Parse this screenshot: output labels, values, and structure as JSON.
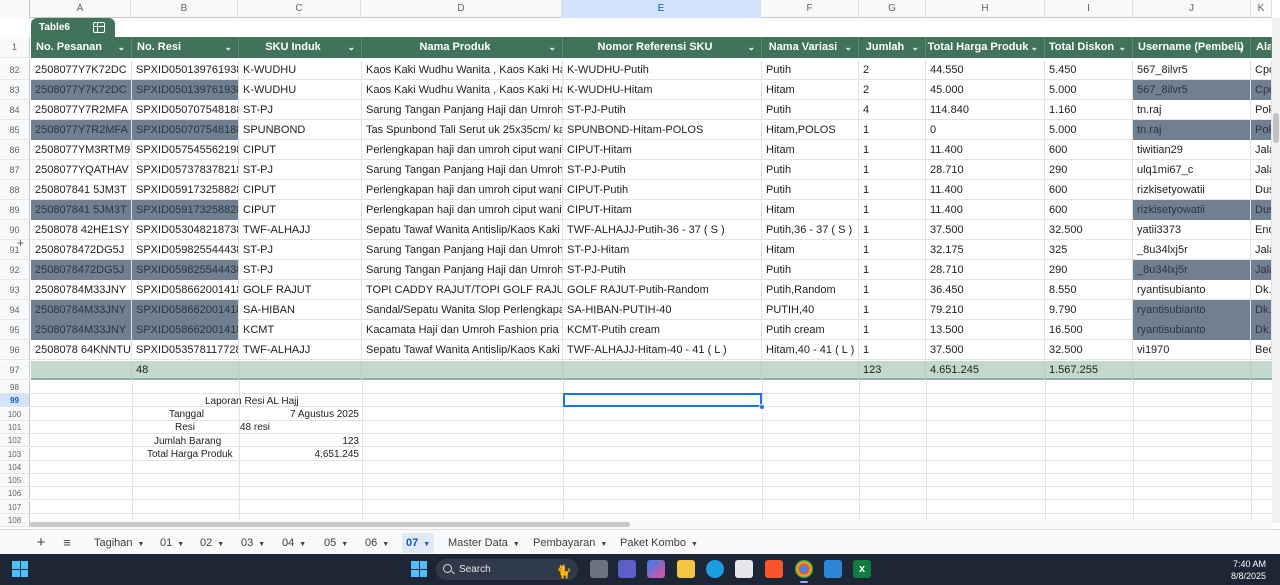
{
  "table_name": "Table6",
  "col_letters": [
    "A",
    "B",
    "C",
    "D",
    "E",
    "F",
    "G",
    "H",
    "I",
    "J",
    "K"
  ],
  "headers": [
    "No. Pesanan",
    "No. Resi",
    "SKU Induk",
    "Nama Produk",
    "Nomor Referensi SKU",
    "Nama Variasi",
    "Jumlah",
    "Total Harga Produk",
    "Total Diskon",
    "Username (Pembeli)",
    "Alan"
  ],
  "header_row_num": "1",
  "rows": [
    {
      "n": "82",
      "hl": false,
      "c": [
        "2508077Y7K72DC",
        "SPXID050139761938",
        "K-WUDHU",
        "Kaos Kaki Wudhu Wanita , Kaos Kaki Haji Da",
        "K-WUDHU-Putih",
        "Putih",
        "2",
        "44.550",
        "5.450",
        "567_8ilvr5",
        "Cpd"
      ]
    },
    {
      "n": "83",
      "hl": true,
      "c": [
        "2508077Y7K72DC",
        "SPXID050139761938",
        "K-WUDHU",
        "Kaos Kaki Wudhu Wanita , Kaos Kaki Haji Da",
        "K-WUDHU-Hitam",
        "Hitam",
        "2",
        "45.000",
        "5.000",
        "567_8ilvr5",
        "Cpd"
      ]
    },
    {
      "n": "84",
      "hl": false,
      "c": [
        "2508077Y7R2MFA",
        "SPXID050707548188",
        "ST-PJ",
        "Sarung Tangan Panjang Haji dan Umroh Wan",
        "ST-PJ-Putih",
        "Putih",
        "4",
        "114.840",
        "1.160",
        "tn.raj",
        "Pok"
      ]
    },
    {
      "n": "85",
      "hl": true,
      "c": [
        "2508077Y7R2MFA",
        "SPXID050707548188",
        "SPUNBOND",
        "Tas Spunbond Tali Serut uk 25x35cm/ kantor",
        "SPUNBOND-Hitam-POLOS",
        "Hitam,POLOS",
        "1",
        "0",
        "5.000",
        "tn.raj",
        "Pok"
      ]
    },
    {
      "n": "86",
      "hl": false,
      "c": [
        "2508077YM3RTM9",
        "SPXID057545562198",
        "CIPUT",
        "Perlengkapan haji dan umroh ciput wanita /ci",
        "CIPUT-Hitam",
        "Hitam",
        "1",
        "11.400",
        "600",
        "tiwitian29",
        "Jala"
      ]
    },
    {
      "n": "87",
      "hl": false,
      "c": [
        "2508077YQATHAV",
        "SPXID057378378218",
        "ST-PJ",
        "Sarung Tangan Panjang Haji dan Umroh Wan",
        "ST-PJ-Putih",
        "Putih",
        "1",
        "28.710",
        "290",
        "ulq1mi67_c",
        "Jala"
      ]
    },
    {
      "n": "88",
      "hl": false,
      "c": [
        "250807841 5JM3T",
        "SPXID059173258828",
        "CIPUT",
        "Perlengkapan haji dan umroh ciput wanita /ci",
        "CIPUT-Putih",
        "Putih",
        "1",
        "11.400",
        "600",
        "rizkisetyowatii",
        "Dus"
      ]
    },
    {
      "n": "89",
      "hl": true,
      "c": [
        "250807841 5JM3T",
        "SPXID059173258828",
        "CIPUT",
        "Perlengkapan haji dan umroh ciput wanita /ci",
        "CIPUT-Hitam",
        "Hitam",
        "1",
        "11.400",
        "600",
        "rizkisetyowatii",
        "Dus"
      ]
    },
    {
      "n": "90",
      "hl": false,
      "c": [
        "2508078 42HE1SY",
        "SPXID053048218738",
        "TWF-ALHAJJ",
        "Sepatu Tawaf Wanita Antislip/Kaos Kaki Tawa",
        "TWF-ALHAJJ-Putih-36 - 37 ( S )",
        "Putih,36 - 37 ( S )",
        "1",
        "37.500",
        "32.500",
        "yatii3373",
        "End"
      ]
    },
    {
      "n": "91",
      "hl": false,
      "c": [
        "2508078472DG5J",
        "SPXID059825544438",
        "ST-PJ",
        "Sarung Tangan Panjang Haji dan Umroh Wan",
        "ST-PJ-Hitam",
        "Hitam",
        "1",
        "32.175",
        "325",
        "_8u34lxj5r",
        "Jala"
      ]
    },
    {
      "n": "92",
      "hl": true,
      "c": [
        "2508078472DG5J",
        "SPXID059825544438",
        "ST-PJ",
        "Sarung Tangan Panjang Haji dan Umroh Wan",
        "ST-PJ-Putih",
        "Putih",
        "1",
        "28.710",
        "290",
        "_8u34lxj5r",
        "Jala"
      ]
    },
    {
      "n": "93",
      "hl": false,
      "c": [
        "25080784M33JNY",
        "SPXID058662001418",
        "GOLF RAJUT",
        "TOPI CADDY RAJUT/TOPI GOLF RAJUT DI",
        "GOLF RAJUT-Putih-Random",
        "Putih,Random",
        "1",
        "36.450",
        "8.550",
        "ryantisubianto",
        "Dk."
      ]
    },
    {
      "n": "94",
      "hl": true,
      "c": [
        "25080784M33JNY",
        "SPXID058662001418",
        "SA-HIBAN",
        "Sandal/Sepatu Wanita Slop Perlengkapan Ha",
        "SA-HIBAN-PUTIH-40",
        "PUTIH,40",
        "1",
        "79.210",
        "9.790",
        "ryantisubianto",
        "Dk."
      ]
    },
    {
      "n": "95",
      "hl": true,
      "c": [
        "25080784M33JNY",
        "SPXID058662001418",
        "KCMT",
        "Kacamata Haji dan Umroh Fashion pria wani",
        "KCMT-Putih cream",
        "Putih cream",
        "1",
        "13.500",
        "16.500",
        "ryantisubianto",
        "Dk."
      ]
    },
    {
      "n": "96",
      "hl": false,
      "c": [
        "2508078 64KNNTU",
        "SPXID053578117728",
        "TWF-ALHAJJ",
        "Sepatu Tawaf Wanita Antislip/Kaos Kaki Tawa",
        "TWF-ALHAJJ-Hitam-40 - 41 ( L )",
        "Hitam,40 - 41 ( L )",
        "1",
        "37.500",
        "32.500",
        "vi1970",
        "Bed"
      ]
    }
  ],
  "total_row": {
    "n": "97",
    "resi_count": "48",
    "jumlah": "123",
    "total_harga": "4.651.245",
    "total_diskon": "1.567.255"
  },
  "lower_rows": [
    "98",
    "99",
    "100",
    "101",
    "102",
    "103",
    "104",
    "105",
    "106",
    "107",
    "108"
  ],
  "summary": {
    "title": "Laporan Resi AL Hajj",
    "tanggal_label": "Tanggal",
    "tanggal_value": "7 Agustus 2025",
    "resi_label": "Resi",
    "resi_value": "48 resi",
    "jumlah_label": "Jumlah Barang",
    "jumlah_value": "123",
    "total_label": "Total Harga Produk",
    "total_value": "4.651.245"
  },
  "sheet_tabs": [
    "Tagihan",
    "01",
    "02",
    "03",
    "04",
    "05",
    "06",
    "07",
    "Master Data",
    "Pembayaran",
    "Paket Kombo"
  ],
  "active_tab": "07",
  "taskbar": {
    "search_placeholder": "Search",
    "time": "7:40 AM",
    "date": "8/8/2025"
  }
}
